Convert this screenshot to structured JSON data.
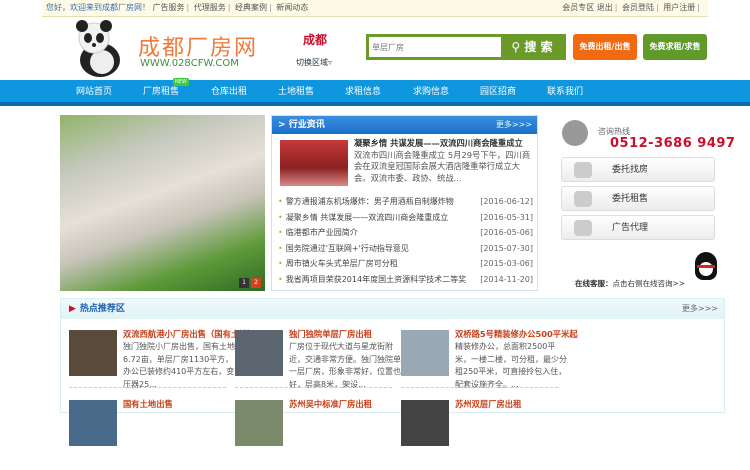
{
  "topbar": {
    "greeting": "您好，欢迎来到成都厂房网！",
    "links": [
      "广告服务",
      "代理服务",
      "经典案例",
      "新闻动态"
    ],
    "right": [
      "会员专区",
      "退出",
      "会员登陆",
      "用户注册"
    ]
  },
  "header": {
    "logo_text": "成都厂房网",
    "logo_url": "WWW.028CFW.COM",
    "city": "成都",
    "switch_label": "切换区域",
    "search_value": "单层厂房",
    "search_button": "搜 索",
    "btn_rent_sell": "免费出租/出售",
    "btn_seek": "免费求租/求售"
  },
  "nav": {
    "items": [
      "网站首页",
      "厂房租售",
      "仓库出租",
      "土地租售",
      "求租信息",
      "求购信息",
      "园区招商",
      "联系我们"
    ],
    "new_badge": "NEW"
  },
  "slider": {
    "pages": [
      "1",
      "2"
    ],
    "current": 2
  },
  "news": {
    "title": "行业资讯",
    "more": "更多>>>",
    "featured_title": "凝聚乡情 共谋发展——双流四川商会隆重成立",
    "featured_summary": "双流市四川商会隆重成立 5月29号下午，四川商会在双流皇冠国际会展大酒店隆重举行成立大会。双流市委、政协、统战...",
    "items": [
      {
        "title": "警方通报浦东机场爆炸：男子用酒瓶自制爆炸物",
        "date": "[2016-06-12]"
      },
      {
        "title": "凝聚乡情 共谋发展——双流四川商会隆重成立",
        "date": "[2016-05-31]"
      },
      {
        "title": "临港都市产业园简介",
        "date": "[2016-05-06]"
      },
      {
        "title": "国务院通过'互联网+'行动指导意见",
        "date": "[2015-07-30]"
      },
      {
        "title": "周市镇火车头式单层厂房可分租",
        "date": "[2015-03-06]"
      },
      {
        "title": "我省两项目荣获2014年度国土资源科学技术二等奖",
        "date": "[2014-11-20]"
      }
    ]
  },
  "contact": {
    "label": "咨询热线",
    "phone": "0512-3686 9497",
    "buttons": [
      "委托找房",
      "委托租售",
      "广告代理"
    ],
    "service_label": "在线客服：",
    "service_text": "点击右侧在线咨询>>"
  },
  "hot": {
    "title": "热点推荐区",
    "more": "更多>>>",
    "items": [
      {
        "title": "双流西航港小厂房出售（国有土地）",
        "summary": "独门独院小厂房出售，国有土地6.72亩，单层厂房1130平方，办公已装修约410平方左右，变压器25..."
      },
      {
        "title": "独门独院单层厂房出租",
        "summary": "厂房位于现代大道与星龙街附近，交通非常方便。独门独院单一层厂房，形象非常好，位置也好，层高8米，架设..."
      },
      {
        "title": "双桥路5号精装修办公500平米起",
        "summary": "精装修办公，总面积2500平米，一楼二楼，可分租，最少分租250平米，可直接拎包入住，配套设施齐全。..."
      },
      {
        "title": "国有土地出售"
      },
      {
        "title": "苏州吴中标准厂房出租"
      },
      {
        "title": "苏州双层厂房出租"
      }
    ]
  }
}
